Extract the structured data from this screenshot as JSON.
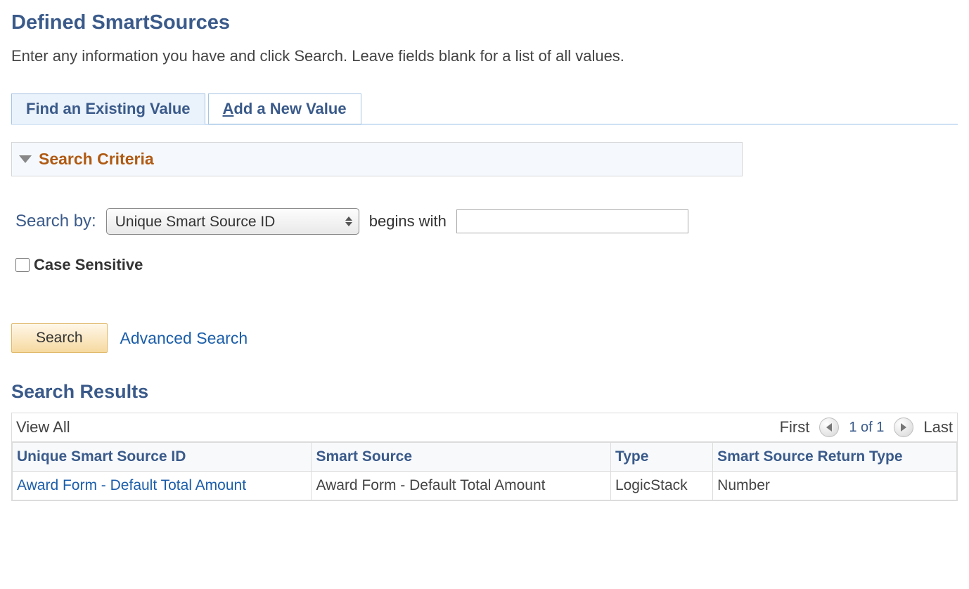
{
  "page": {
    "title": "Defined SmartSources",
    "instructions": "Enter any information you have and click Search. Leave fields blank for a list of all values."
  },
  "tabs": {
    "find": "Find an Existing Value",
    "add_prefix": "A",
    "add_suffix": "dd a New Value"
  },
  "criteria": {
    "header": "Search Criteria",
    "search_by_label": "Search by:",
    "field_options": [
      "Unique Smart Source ID"
    ],
    "field_selected": "Unique Smart Source ID",
    "begins_with": "begins with",
    "value": "",
    "case_sensitive_label": "Case Sensitive"
  },
  "actions": {
    "search": "Search",
    "advanced": "Advanced Search"
  },
  "results": {
    "title": "Search Results",
    "view_all": "View All",
    "first": "First",
    "pager": "1 of 1",
    "last": "Last",
    "columns": [
      "Unique Smart Source ID",
      "Smart Source",
      "Type",
      "Smart Source Return Type"
    ],
    "rows": [
      {
        "id": "Award Form - Default Total Amount",
        "smart_source": "Award Form - Default Total Amount",
        "type": "LogicStack",
        "return_type": "Number"
      }
    ]
  }
}
